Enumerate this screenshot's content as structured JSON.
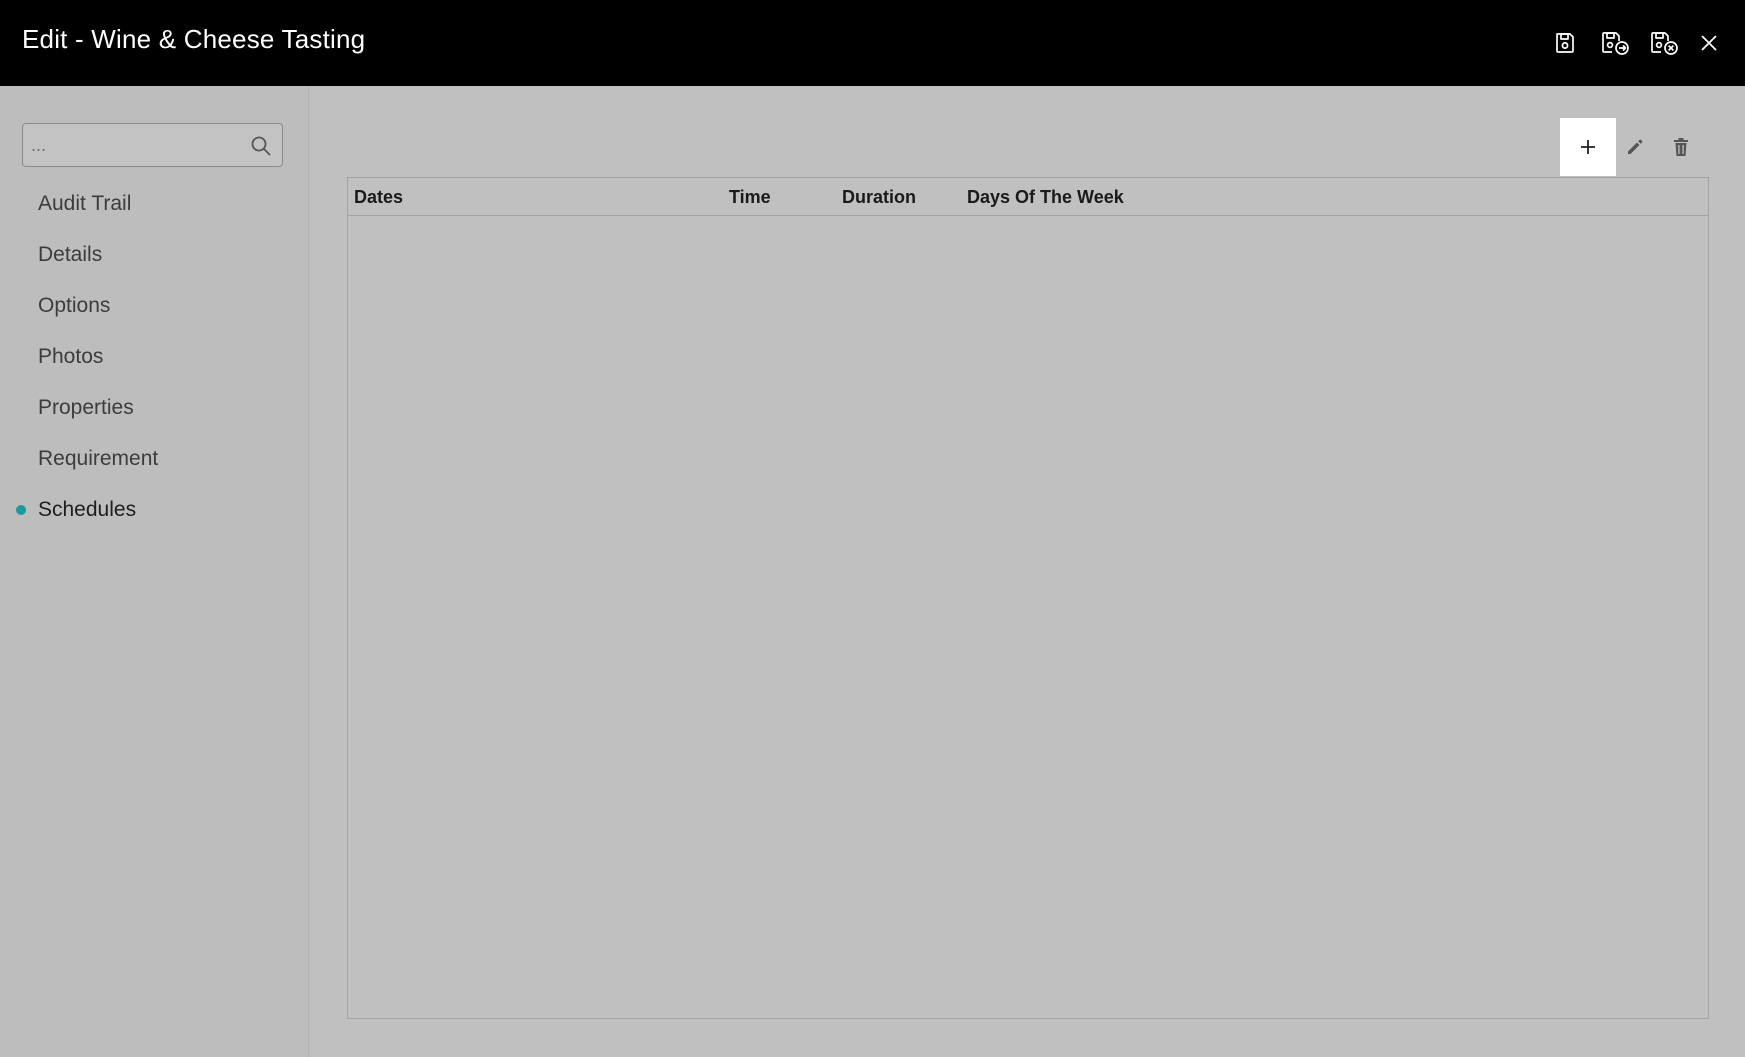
{
  "window": {
    "title": "Edit - Wine & Cheese Tasting",
    "actions": [
      {
        "name": "save-icon",
        "label": "Save"
      },
      {
        "name": "save-and-open-icon",
        "label": "Save & Open"
      },
      {
        "name": "save-and-close-icon",
        "label": "Save & Close"
      },
      {
        "name": "close-icon",
        "label": "Close"
      }
    ]
  },
  "sidebar": {
    "search": {
      "placeholder": "...",
      "value": ""
    },
    "items": [
      {
        "label": "Audit Trail",
        "active": false
      },
      {
        "label": "Details",
        "active": false
      },
      {
        "label": "Options",
        "active": false
      },
      {
        "label": "Photos",
        "active": false
      },
      {
        "label": "Properties",
        "active": false
      },
      {
        "label": "Requirement",
        "active": false
      },
      {
        "label": "Schedules",
        "active": true
      }
    ]
  },
  "toolbar": {
    "buttons": [
      {
        "name": "add-icon",
        "state": "highlighted"
      },
      {
        "name": "edit-icon",
        "state": "normal"
      },
      {
        "name": "delete-icon",
        "state": "normal"
      }
    ]
  },
  "grid": {
    "columns": [
      "Dates",
      "Time",
      "Duration",
      "Days Of The Week"
    ],
    "rows": []
  },
  "colors": {
    "titlebar": "#000000",
    "background": "#c0c0c0",
    "active_indicator": "#1a9a9c"
  }
}
